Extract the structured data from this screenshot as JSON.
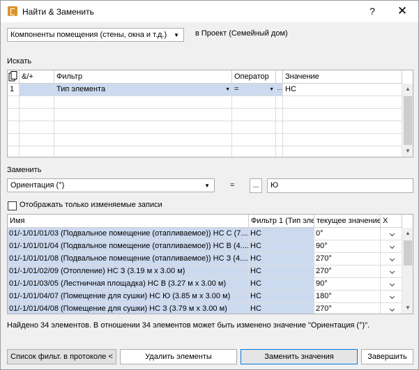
{
  "window": {
    "title": "Найти & Заменить",
    "help_label": "?",
    "close_label": "✕"
  },
  "top": {
    "category_select": "Компоненты помещения (стены, окна и т.д.)",
    "scope_text": "в Проект (Семейный дом)"
  },
  "search": {
    "label": "Искать",
    "headers": {
      "logic": "&/+",
      "filter": "Фильтр",
      "operator": "Оператор",
      "value": "Значение"
    },
    "rows": [
      {
        "num": "1",
        "filter": "Тип элемента",
        "operator": "=",
        "value": "НС"
      }
    ]
  },
  "replace": {
    "label": "Заменить",
    "property_select": "Ориентация (°)",
    "equals": "=",
    "dots_button": "...",
    "value": "Ю"
  },
  "show_changed_only": {
    "label": "Отображать только изменяемые записи",
    "checked": false
  },
  "results": {
    "headers": {
      "name": "Имя",
      "filter1": "Фильтр 1 (Тип эле",
      "current": "текущее значение",
      "x": "X"
    },
    "rows": [
      {
        "name": "01/-1/01/01/03 (Подвальное помещение (отапливаемое)) НС С (7....",
        "filter1": "НС",
        "current": "0°"
      },
      {
        "name": "01/-1/01/01/04 (Подвальное помещение (отапливаемое)) НС В (4....",
        "filter1": "НС",
        "current": "90°"
      },
      {
        "name": "01/-1/01/01/08 (Подвальное помещение (отапливаемое)) НС З (4....",
        "filter1": "НС",
        "current": "270°"
      },
      {
        "name": "01/-1/01/02/09 (Отопление) НС З (3.19 м x 3.00 м)",
        "filter1": "НС",
        "current": "270°"
      },
      {
        "name": "01/-1/01/03/05 (Лестничная площадка) НС В (3.27 м x 3.00 м)",
        "filter1": "НС",
        "current": "90°"
      },
      {
        "name": "01/-1/01/04/07 (Помещение для сушки) НС Ю (3.85 м x 3.00 м)",
        "filter1": "НС",
        "current": "180°"
      },
      {
        "name": "01/-1/01/04/08 (Помещение для сушки) НС З (3.79 м x 3.00 м)",
        "filter1": "НС",
        "current": "270°"
      }
    ]
  },
  "status_text": "Найдено 34 элементов. В отношении 34 элементов может быть изменено значение \"Ориентация (°)\".",
  "buttons": {
    "filter_list": "Список фильт. в протоколе <",
    "delete": "Удалить элементы",
    "replace": "Заменить значения",
    "finish": "Завершить"
  },
  "icons": {
    "app": "app-logo-icon",
    "copy": "copy-pages-icon",
    "dropdown": "dropdown-arrow-icon",
    "chevron": "chevron-down-icon"
  }
}
